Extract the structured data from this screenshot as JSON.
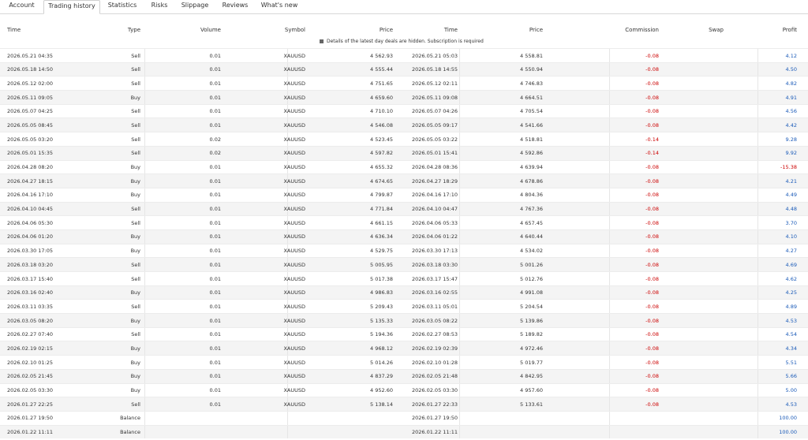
{
  "tabs": [
    "Account",
    "Trading history",
    "Statistics",
    "Risks",
    "Slippage",
    "Reviews",
    "What's new"
  ],
  "active_tab": "Trading history",
  "columns": {
    "time": "Time",
    "type": "Type",
    "volume": "Volume",
    "symbol": "Symbol",
    "price": "Price",
    "time2": "Time",
    "price2": "Price",
    "commission": "Commission",
    "swap": "Swap",
    "profit": "Profit"
  },
  "notice": "Details of the latest day deals are hidden. Subscription is required",
  "rows": [
    {
      "time": "2026.05.21 04:35",
      "type": "Sell",
      "volume": "0.01",
      "symbol": "XAUUSD",
      "price": "4 562.93",
      "time2": "2026.05.21 05:03",
      "price2": "4 558.81",
      "commission": "-0.08",
      "profit": "4.12"
    },
    {
      "time": "2026.05.18 14:50",
      "type": "Sell",
      "volume": "0.01",
      "symbol": "XAUUSD",
      "price": "4 555.44",
      "time2": "2026.05.18 14:55",
      "price2": "4 550.94",
      "commission": "-0.08",
      "profit": "4.50"
    },
    {
      "time": "2026.05.12 02:00",
      "type": "Sell",
      "volume": "0.01",
      "symbol": "XAUUSD",
      "price": "4 751.65",
      "time2": "2026.05.12 02:11",
      "price2": "4 746.83",
      "commission": "-0.08",
      "profit": "4.82"
    },
    {
      "time": "2026.05.11 09:05",
      "type": "Buy",
      "volume": "0.01",
      "symbol": "XAUUSD",
      "price": "4 659.60",
      "time2": "2026.05.11 09:08",
      "price2": "4 664.51",
      "commission": "-0.08",
      "profit": "4.91"
    },
    {
      "time": "2026.05.07 04:25",
      "type": "Sell",
      "volume": "0.01",
      "symbol": "XAUUSD",
      "price": "4 710.10",
      "time2": "2026.05.07 04:26",
      "price2": "4 705.54",
      "commission": "-0.08",
      "profit": "4.56"
    },
    {
      "time": "2026.05.05 08:45",
      "type": "Sell",
      "volume": "0.01",
      "symbol": "XAUUSD",
      "price": "4 546.08",
      "time2": "2026.05.05 09:17",
      "price2": "4 541.66",
      "commission": "-0.08",
      "profit": "4.42"
    },
    {
      "time": "2026.05.05 03:20",
      "type": "Sell",
      "volume": "0.02",
      "symbol": "XAUUSD",
      "price": "4 523.45",
      "time2": "2026.05.05 03:22",
      "price2": "4 518.81",
      "commission": "-0.14",
      "profit": "9.28"
    },
    {
      "time": "2026.05.01 15:35",
      "type": "Sell",
      "volume": "0.02",
      "symbol": "XAUUSD",
      "price": "4 597.82",
      "time2": "2026.05.01 15:41",
      "price2": "4 592.86",
      "commission": "-0.14",
      "profit": "9.92"
    },
    {
      "time": "2026.04.28 08:20",
      "type": "Buy",
      "volume": "0.01",
      "symbol": "XAUUSD",
      "price": "4 655.32",
      "time2": "2026.04.28 08:36",
      "price2": "4 639.94",
      "commission": "-0.08",
      "profit": "-15.38"
    },
    {
      "time": "2026.04.27 18:15",
      "type": "Buy",
      "volume": "0.01",
      "symbol": "XAUUSD",
      "price": "4 674.65",
      "time2": "2026.04.27 18:29",
      "price2": "4 678.86",
      "commission": "-0.08",
      "profit": "4.21"
    },
    {
      "time": "2026.04.16 17:10",
      "type": "Buy",
      "volume": "0.01",
      "symbol": "XAUUSD",
      "price": "4 799.87",
      "time2": "2026.04.16 17:10",
      "price2": "4 804.36",
      "commission": "-0.08",
      "profit": "4.49"
    },
    {
      "time": "2026.04.10 04:45",
      "type": "Sell",
      "volume": "0.01",
      "symbol": "XAUUSD",
      "price": "4 771.84",
      "time2": "2026.04.10 04:47",
      "price2": "4 767.36",
      "commission": "-0.08",
      "profit": "4.48"
    },
    {
      "time": "2026.04.06 05:30",
      "type": "Sell",
      "volume": "0.01",
      "symbol": "XAUUSD",
      "price": "4 661.15",
      "time2": "2026.04.06 05:33",
      "price2": "4 657.45",
      "commission": "-0.08",
      "profit": "3.70"
    },
    {
      "time": "2026.04.06 01:20",
      "type": "Buy",
      "volume": "0.01",
      "symbol": "XAUUSD",
      "price": "4 636.34",
      "time2": "2026.04.06 01:22",
      "price2": "4 640.44",
      "commission": "-0.08",
      "profit": "4.10"
    },
    {
      "time": "2026.03.30 17:05",
      "type": "Buy",
      "volume": "0.01",
      "symbol": "XAUUSD",
      "price": "4 529.75",
      "time2": "2026.03.30 17:13",
      "price2": "4 534.02",
      "commission": "-0.08",
      "profit": "4.27"
    },
    {
      "time": "2026.03.18 03:20",
      "type": "Sell",
      "volume": "0.01",
      "symbol": "XAUUSD",
      "price": "5 005.95",
      "time2": "2026.03.18 03:30",
      "price2": "5 001.26",
      "commission": "-0.08",
      "profit": "4.69"
    },
    {
      "time": "2026.03.17 15:40",
      "type": "Sell",
      "volume": "0.01",
      "symbol": "XAUUSD",
      "price": "5 017.38",
      "time2": "2026.03.17 15:47",
      "price2": "5 012.76",
      "commission": "-0.08",
      "profit": "4.62"
    },
    {
      "time": "2026.03.16 02:40",
      "type": "Buy",
      "volume": "0.01",
      "symbol": "XAUUSD",
      "price": "4 986.83",
      "time2": "2026.03.16 02:55",
      "price2": "4 991.08",
      "commission": "-0.08",
      "profit": "4.25"
    },
    {
      "time": "2026.03.11 03:35",
      "type": "Sell",
      "volume": "0.01",
      "symbol": "XAUUSD",
      "price": "5 209.43",
      "time2": "2026.03.11 05:01",
      "price2": "5 204.54",
      "commission": "-0.08",
      "profit": "4.89"
    },
    {
      "time": "2026.03.05 08:20",
      "type": "Buy",
      "volume": "0.01",
      "symbol": "XAUUSD",
      "price": "5 135.33",
      "time2": "2026.03.05 08:22",
      "price2": "5 139.86",
      "commission": "-0.08",
      "profit": "4.53"
    },
    {
      "time": "2026.02.27 07:40",
      "type": "Sell",
      "volume": "0.01",
      "symbol": "XAUUSD",
      "price": "5 194.36",
      "time2": "2026.02.27 08:53",
      "price2": "5 189.82",
      "commission": "-0.08",
      "profit": "4.54"
    },
    {
      "time": "2026.02.19 02:15",
      "type": "Buy",
      "volume": "0.01",
      "symbol": "XAUUSD",
      "price": "4 968.12",
      "time2": "2026.02.19 02:39",
      "price2": "4 972.46",
      "commission": "-0.08",
      "profit": "4.34"
    },
    {
      "time": "2026.02.10 01:25",
      "type": "Buy",
      "volume": "0.01",
      "symbol": "XAUUSD",
      "price": "5 014.26",
      "time2": "2026.02.10 01:28",
      "price2": "5 019.77",
      "commission": "-0.08",
      "profit": "5.51"
    },
    {
      "time": "2026.02.05 21:45",
      "type": "Buy",
      "volume": "0.01",
      "symbol": "XAUUSD",
      "price": "4 837.29",
      "time2": "2026.02.05 21:48",
      "price2": "4 842.95",
      "commission": "-0.08",
      "profit": "5.66"
    },
    {
      "time": "2026.02.05 03:30",
      "type": "Buy",
      "volume": "0.01",
      "symbol": "XAUUSD",
      "price": "4 952.60",
      "time2": "2026.02.05 03:30",
      "price2": "4 957.60",
      "commission": "-0.08",
      "profit": "5.00"
    },
    {
      "time": "2026.01.27 22:25",
      "type": "Sell",
      "volume": "0.01",
      "symbol": "XAUUSD",
      "price": "5 138.14",
      "time2": "2026.01.27 22:33",
      "price2": "5 133.61",
      "commission": "-0.08",
      "profit": "4.53"
    },
    {
      "time": "2026.01.27 19:50",
      "type": "Balance",
      "volume": "",
      "symbol": "",
      "price": "",
      "time2": "2026.01.27 19:50",
      "price2": "",
      "commission": "",
      "profit": "100.00"
    },
    {
      "time": "2026.01.22 11:11",
      "type": "Balance",
      "volume": "",
      "symbol": "",
      "price": "",
      "time2": "2026.01.22 11:11",
      "price2": "",
      "commission": "",
      "profit": "100.00"
    }
  ]
}
